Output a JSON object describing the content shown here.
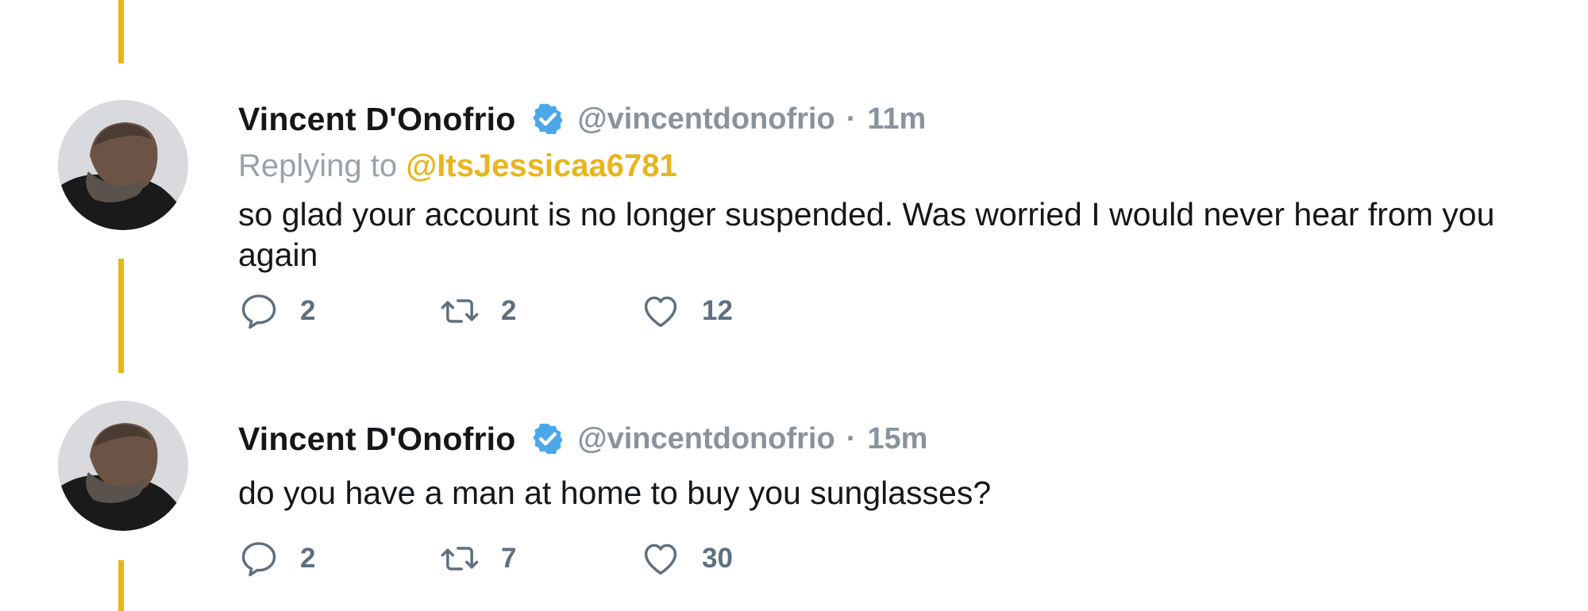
{
  "tweets": [
    {
      "display_name": "Vincent D'Onofrio",
      "verified_icon": "verified-badge-icon",
      "handle": "@vincentdonofrio",
      "separator": "·",
      "time": "11m",
      "replying_prefix": "Replying to",
      "replying_to": "@ItsJessicaa6781",
      "text": "so glad your account is no longer suspended. Was worried I would never hear from you again",
      "replies": "2",
      "retweets": "2",
      "likes": "12"
    },
    {
      "display_name": "Vincent D'Onofrio",
      "verified_icon": "verified-badge-icon",
      "handle": "@vincentdonofrio",
      "separator": "·",
      "time": "15m",
      "text": "do you have a man at home to buy you sunglasses?",
      "replies": "2",
      "retweets": "7",
      "likes": "30"
    }
  ],
  "colors": {
    "thread_line": "#e8b51c",
    "mention": "#e8b51c",
    "verified": "#4aa8ea",
    "muted": "#8a939c",
    "action": "#5f6f7f"
  }
}
